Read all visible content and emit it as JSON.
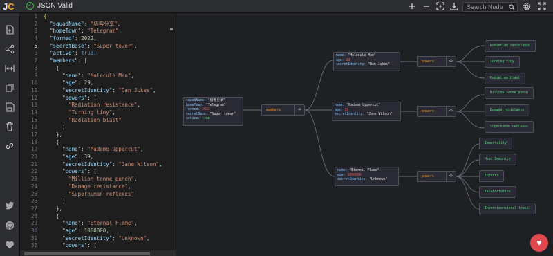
{
  "app": {
    "logo_j": "J",
    "logo_c": "C",
    "status": "JSON Valid"
  },
  "toolbar": {
    "search_placeholder": "Search Node"
  },
  "editor": {
    "current_line": 5,
    "lines": [
      [
        [
          "p",
          "{"
        ]
      ],
      [
        [
          "t",
          "  "
        ],
        [
          "k",
          "\"squadName\""
        ],
        [
          "t",
          ": "
        ],
        [
          "s",
          "\"极客分享\""
        ],
        [
          "t",
          ","
        ]
      ],
      [
        [
          "t",
          "  "
        ],
        [
          "k",
          "\"homeTown\""
        ],
        [
          "t",
          ": "
        ],
        [
          "s",
          "\"Telegram\""
        ],
        [
          "t",
          ","
        ]
      ],
      [
        [
          "t",
          "  "
        ],
        [
          "k",
          "\"formed\""
        ],
        [
          "t",
          ": "
        ],
        [
          "n",
          "2022"
        ],
        [
          "t",
          ","
        ]
      ],
      [
        [
          "t",
          "  "
        ],
        [
          "k",
          "\"secretBase\""
        ],
        [
          "t",
          ": "
        ],
        [
          "s",
          "\"Super tower\""
        ],
        [
          "t",
          ","
        ]
      ],
      [
        [
          "t",
          "  "
        ],
        [
          "k",
          "\"active\""
        ],
        [
          "t",
          ": "
        ],
        [
          "b",
          "true"
        ],
        [
          "t",
          ","
        ]
      ],
      [
        [
          "t",
          "  "
        ],
        [
          "k",
          "\"members\""
        ],
        [
          "t",
          ": ["
        ]
      ],
      [
        [
          "t",
          "    {"
        ]
      ],
      [
        [
          "t",
          "      "
        ],
        [
          "k",
          "\"name\""
        ],
        [
          "t",
          ": "
        ],
        [
          "s",
          "\"Molecule Man\""
        ],
        [
          "t",
          ","
        ]
      ],
      [
        [
          "t",
          "      "
        ],
        [
          "k",
          "\"age\""
        ],
        [
          "t",
          ": "
        ],
        [
          "n",
          "29"
        ],
        [
          "t",
          ","
        ]
      ],
      [
        [
          "t",
          "      "
        ],
        [
          "k",
          "\"secretIdentity\""
        ],
        [
          "t",
          ": "
        ],
        [
          "s",
          "\"Dan Jukes\""
        ],
        [
          "t",
          ","
        ]
      ],
      [
        [
          "t",
          "      "
        ],
        [
          "k",
          "\"powers\""
        ],
        [
          "t",
          ": ["
        ]
      ],
      [
        [
          "t",
          "        "
        ],
        [
          "s",
          "\"Radiation resistance\""
        ],
        [
          "t",
          ","
        ]
      ],
      [
        [
          "t",
          "        "
        ],
        [
          "s",
          "\"Turning tiny\""
        ],
        [
          "t",
          ","
        ]
      ],
      [
        [
          "t",
          "        "
        ],
        [
          "s",
          "\"Radiation blast\""
        ]
      ],
      [
        [
          "t",
          "      ]"
        ]
      ],
      [
        [
          "t",
          "    },"
        ]
      ],
      [
        [
          "t",
          "    {"
        ]
      ],
      [
        [
          "t",
          "      "
        ],
        [
          "k",
          "\"name\""
        ],
        [
          "t",
          ": "
        ],
        [
          "s",
          "\"Madame Uppercut\""
        ],
        [
          "t",
          ","
        ]
      ],
      [
        [
          "t",
          "      "
        ],
        [
          "k",
          "\"age\""
        ],
        [
          "t",
          ": "
        ],
        [
          "n",
          "39"
        ],
        [
          "t",
          ","
        ]
      ],
      [
        [
          "t",
          "      "
        ],
        [
          "k",
          "\"secretIdentity\""
        ],
        [
          "t",
          ": "
        ],
        [
          "s",
          "\"Jane Wilson\""
        ],
        [
          "t",
          ","
        ]
      ],
      [
        [
          "t",
          "      "
        ],
        [
          "k",
          "\"powers\""
        ],
        [
          "t",
          ": ["
        ]
      ],
      [
        [
          "t",
          "        "
        ],
        [
          "s",
          "\"Million tonne punch\""
        ],
        [
          "t",
          ","
        ]
      ],
      [
        [
          "t",
          "        "
        ],
        [
          "s",
          "\"Damage resistance\""
        ],
        [
          "t",
          ","
        ]
      ],
      [
        [
          "t",
          "        "
        ],
        [
          "s",
          "\"Superhuman reflexes\""
        ]
      ],
      [
        [
          "t",
          "      ]"
        ]
      ],
      [
        [
          "t",
          "    },"
        ]
      ],
      [
        [
          "t",
          "    {"
        ]
      ],
      [
        [
          "t",
          "      "
        ],
        [
          "k",
          "\"name\""
        ],
        [
          "t",
          ": "
        ],
        [
          "s",
          "\"Eternal Flame\""
        ],
        [
          "t",
          ","
        ]
      ],
      [
        [
          "t",
          "      "
        ],
        [
          "k",
          "\"age\""
        ],
        [
          "t",
          ": "
        ],
        [
          "n",
          "1000000"
        ],
        [
          "t",
          ","
        ]
      ],
      [
        [
          "t",
          "      "
        ],
        [
          "k",
          "\"secretIdentity\""
        ],
        [
          "t",
          ": "
        ],
        [
          "s",
          "\"Unknown\""
        ],
        [
          "t",
          ","
        ]
      ],
      [
        [
          "t",
          "      "
        ],
        [
          "k",
          "\"powers\""
        ],
        [
          "t",
          ": ["
        ]
      ]
    ]
  },
  "graph": {
    "root": [
      {
        "k": "squadName",
        "v": "\"极客分享\"",
        "c": "nv"
      },
      {
        "k": "homeTown",
        "v": "\"Telegram\"",
        "c": "nv"
      },
      {
        "k": "formed",
        "v": "2022",
        "c": "nn"
      },
      {
        "k": "secretBase",
        "v": "\"Super tower\"",
        "c": "nv"
      },
      {
        "k": "active",
        "v": "true",
        "c": "nb"
      }
    ],
    "members_label": "members",
    "powers_label": "powers",
    "expand_symbol": "∞",
    "people": [
      [
        {
          "k": "name",
          "v": "\"Molecule Man\"",
          "c": "nv"
        },
        {
          "k": "age",
          "v": "29",
          "c": "nn"
        },
        {
          "k": "secretIdentity",
          "v": "\"Dan Jukes\"",
          "c": "nv"
        }
      ],
      [
        {
          "k": "name",
          "v": "\"Madame Uppercut\"",
          "c": "nv"
        },
        {
          "k": "age",
          "v": "39",
          "c": "nn"
        },
        {
          "k": "secretIdentity",
          "v": "\"Jane Wilson\"",
          "c": "nv"
        }
      ],
      [
        {
          "k": "name",
          "v": "\"Eternal Flame\"",
          "c": "nv"
        },
        {
          "k": "age",
          "v": "1000000",
          "c": "nn"
        },
        {
          "k": "secretIdentity",
          "v": "\"Unknown\"",
          "c": "nv"
        }
      ]
    ],
    "leaves": [
      "Radiation resistance",
      "Turning tiny",
      "Radiation blast",
      "Million tonne punch",
      "Damage resistance",
      "Superhuman reflexes",
      "Immortality",
      "Heat Immunity",
      "Inferno",
      "Teleportation",
      "Interdimensional travel"
    ]
  }
}
